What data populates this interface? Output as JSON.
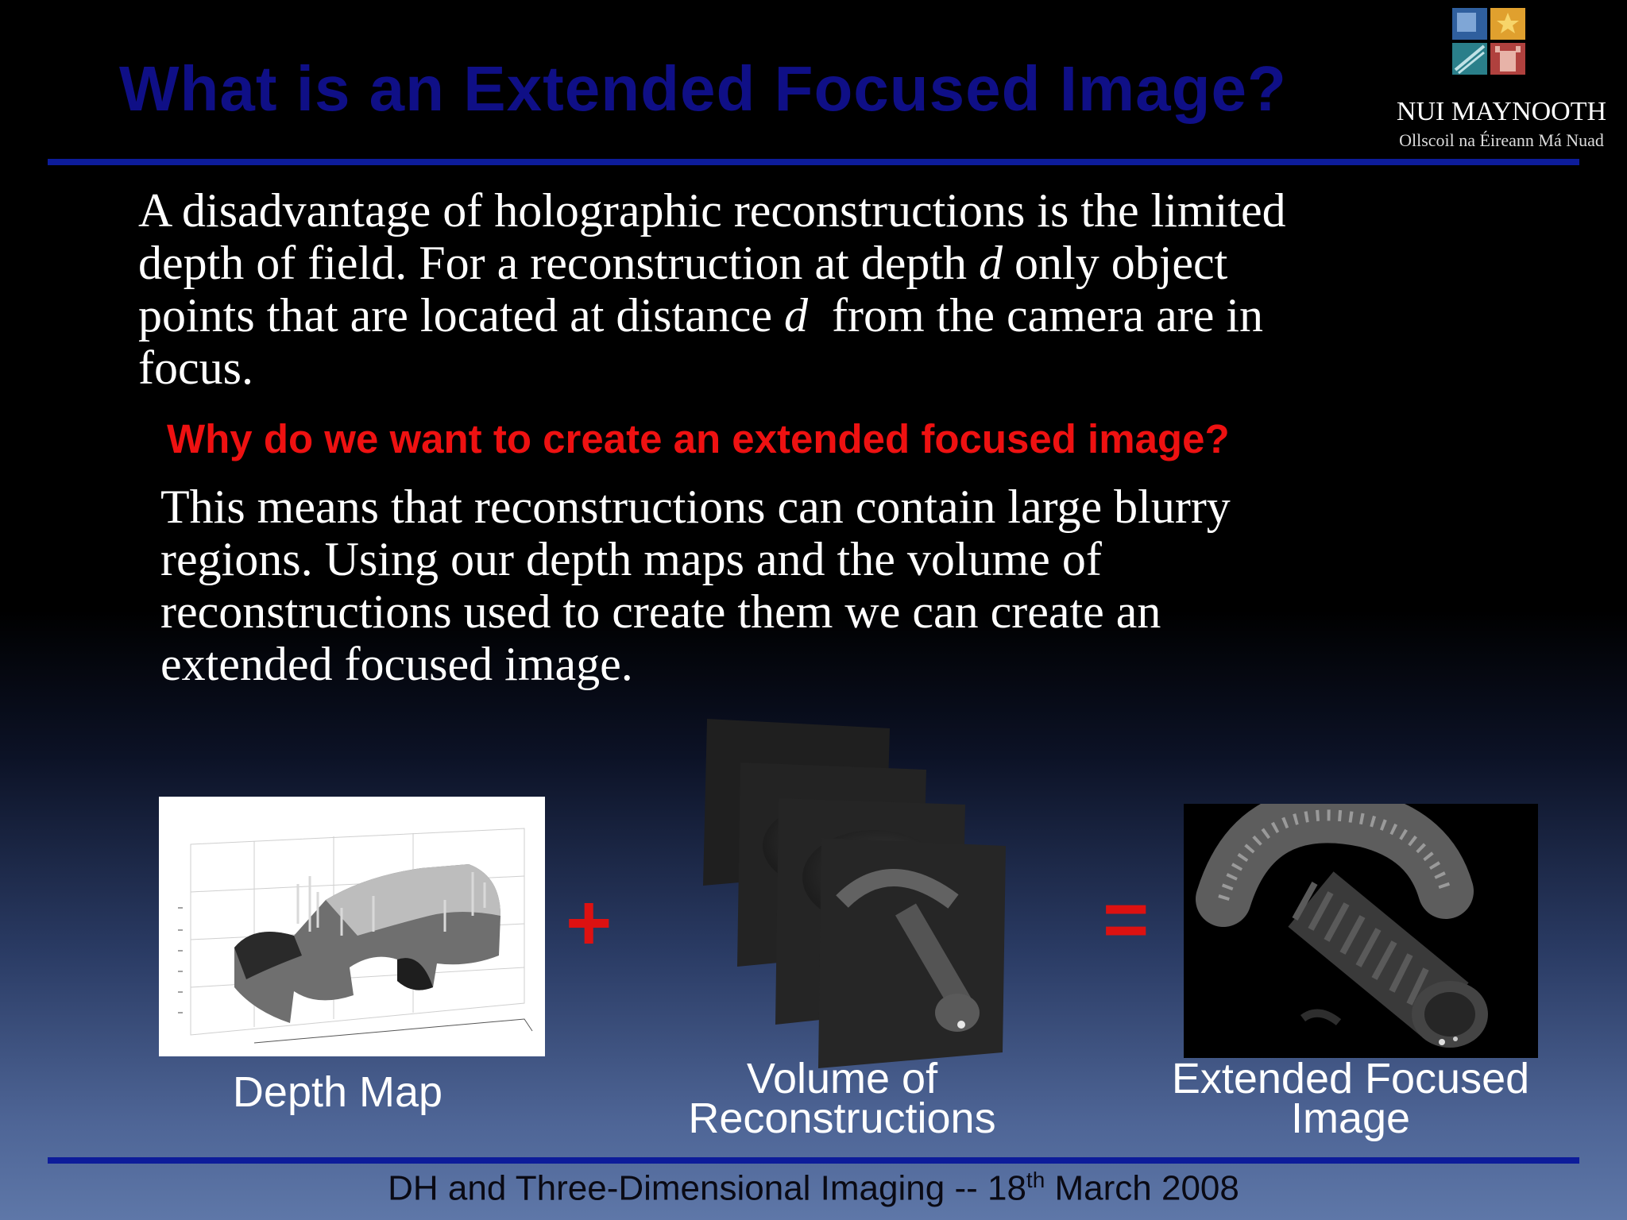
{
  "title": "What is an Extended Focused Image?",
  "logo": {
    "name": "NUI MAYNOOTH",
    "subtitle": "Ollscoil na Éireann Má Nuad"
  },
  "intro_lines": [
    "A disadvantage of holographic reconstructions is the limited",
    "depth of field. For a reconstruction at depth",
    "d",
    "only object",
    "points that are located at distance",
    "d",
    "from the camera are in",
    "focus."
  ],
  "question": "Why do we want to create an extended focused image?",
  "answer_lines": [
    "This means that reconstructions can contain large blurry",
    "regions. Using our depth maps and the volume of",
    "reconstructions used to create them we can create an",
    "extended focused image."
  ],
  "equation": {
    "plus": "+",
    "equals": "=",
    "captions": {
      "depth_map": "Depth Map",
      "volume_line1": "Volume of",
      "volume_line2": "Reconstructions",
      "efi_line1": "Extended Focused",
      "efi_line2": "Image"
    }
  },
  "footer": {
    "before": "DH and Three-Dimensional Imaging  -- 18",
    "sup": "th",
    "after": " March 2008"
  },
  "colors": {
    "title": "#0f0f86",
    "rule": "#0d1c9a",
    "question": "#ee1111",
    "operators": "#dd1111"
  }
}
